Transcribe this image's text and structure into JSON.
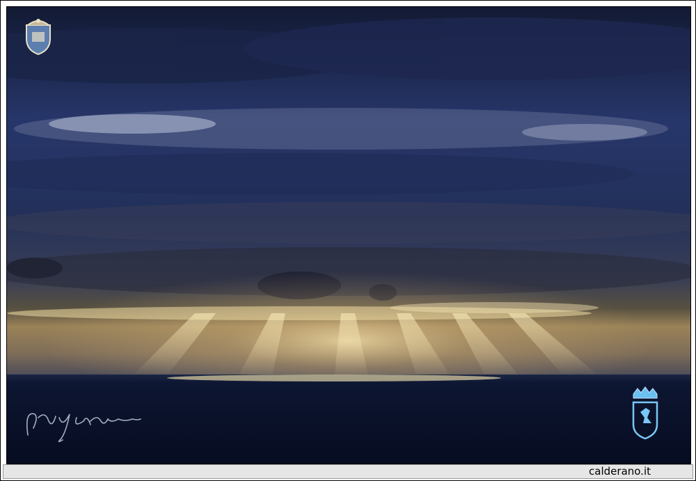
{
  "footer": {
    "site_label": "calderano.it"
  },
  "logos": {
    "left": "coat-of-arms",
    "right": "coat-of-arms-blue"
  },
  "colors": {
    "sky_top": "#1c2340",
    "sky_mid": "#2f3f6e",
    "horizon_glow": "#e8d29a",
    "sea": "#0c1530"
  }
}
